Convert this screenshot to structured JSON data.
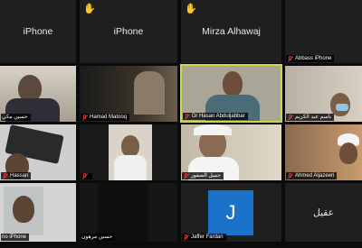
{
  "participants": [
    {
      "name": "iPhone",
      "type": "name_only",
      "muted": false,
      "hand": false
    },
    {
      "name": "iPhone",
      "type": "name_only",
      "muted": false,
      "hand": true,
      "hand_icon": "raised-hand-icon"
    },
    {
      "name": "Mirza Alhawaj",
      "type": "name_only",
      "muted": false,
      "hand": true,
      "hand_icon": "raised-hand-icon"
    },
    {
      "name": "Abbass iPhone",
      "type": "blank",
      "muted": true
    },
    {
      "name": "حسين مكي",
      "type": "video",
      "muted": false
    },
    {
      "name": "Hamad Matooq",
      "type": "video",
      "muted": true
    },
    {
      "name": "Dr Hasan Abduljabbar",
      "type": "video",
      "muted": true,
      "active_speaker": true
    },
    {
      "name": "باسم عبد الكريم",
      "type": "video",
      "muted": true
    },
    {
      "name": "Hassan",
      "type": "video",
      "muted": true
    },
    {
      "name": "",
      "type": "video",
      "muted": false
    },
    {
      "name": "جميل الصفور",
      "type": "video",
      "muted": true
    },
    {
      "name": "Ahmed Aljazeeri",
      "type": "video",
      "muted": true
    },
    {
      "name": "no iPhone",
      "type": "video",
      "muted": false
    },
    {
      "name": "حسين مرهون",
      "type": "video",
      "muted": false
    },
    {
      "name": "Jaffer Fardan",
      "type": "avatar",
      "avatar_letter": "J",
      "muted": true
    },
    {
      "name": "عقيل",
      "type": "name_only",
      "muted": false
    }
  ],
  "colors": {
    "background": "#0b0b0b",
    "tile": "#1f1f1f",
    "active_speaker_border": "#c6d94a",
    "muted_icon": "#d23b3b",
    "avatar": "#1a73c9"
  }
}
